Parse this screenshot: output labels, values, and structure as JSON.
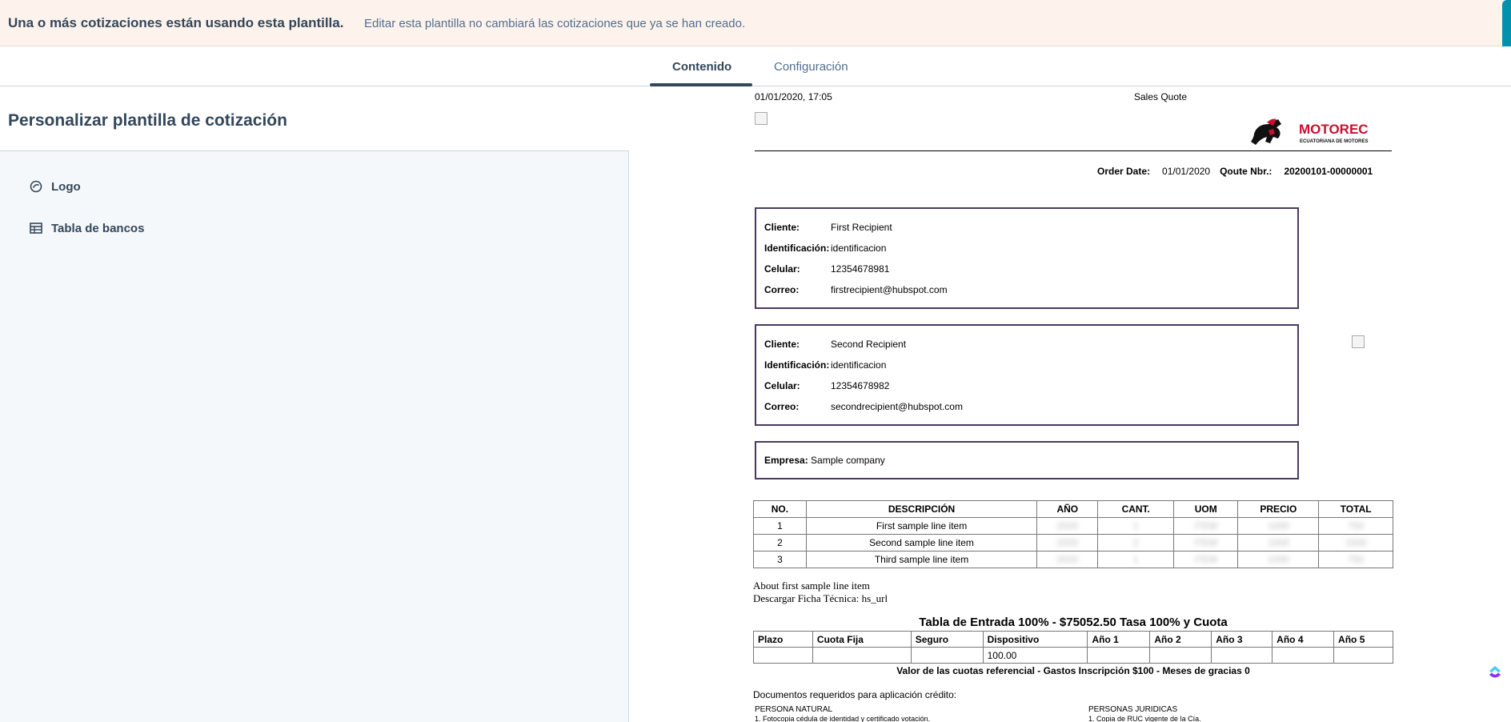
{
  "banner": {
    "title": "Una o más cotizaciones están usando esta plantilla.",
    "message": "Editar esta plantilla no cambiará las cotizaciones que ya se han creado."
  },
  "tabs": [
    {
      "label": "Contenido",
      "active": true
    },
    {
      "label": "Configuración",
      "active": false
    }
  ],
  "sidebar": {
    "title": "Personalizar plantilla de cotización",
    "items": [
      {
        "label": "Logo",
        "icon": "logo-icon"
      },
      {
        "label": "Tabla de bancos",
        "icon": "table-icon"
      }
    ]
  },
  "preview": {
    "date": "01/01/2020, 17:05",
    "doc_title": "Sales Quote",
    "logo": {
      "brand": "MOTOREC",
      "tagline": "ECUATORIANA DE MOTORES",
      "color": "#c8102e"
    },
    "order_date_label": "Order Date:",
    "order_date": "01/01/2020",
    "quote_nbr_label": "Qoute Nbr.:",
    "quote_nbr": "20200101-00000001",
    "recipients": [
      {
        "cliente_label": "Cliente:",
        "cliente": "First Recipient",
        "id_label": "Identificación:",
        "id": "identificacion",
        "cel_label": "Celular:",
        "cel": "12354678981",
        "correo_label": "Correo:",
        "correo": "firstrecipient@hubspot.com"
      },
      {
        "cliente_label": "Cliente:",
        "cliente": "Second Recipient",
        "id_label": "Identificación:",
        "id": "identificacion",
        "cel_label": "Celular:",
        "cel": "12354678982",
        "correo_label": "Correo:",
        "correo": "secondrecipient@hubspot.com"
      }
    ],
    "empresa_label": "Empresa:",
    "empresa": "Sample company",
    "items_table": {
      "headers": [
        "NO.",
        "DESCRIPCIÓN",
        "AÑO",
        "CANT.",
        "UOM",
        "PRECIO",
        "TOTAL"
      ],
      "rows": [
        [
          "1",
          "First sample line item",
          "2020",
          "1",
          "ITEM",
          "1000",
          "750"
        ],
        [
          "2",
          "Second sample line item",
          "2020",
          "2",
          "ITEM",
          "1000",
          "1500"
        ],
        [
          "3",
          "Third sample line item",
          "2020",
          "1",
          "ITEM",
          "1000",
          "750"
        ]
      ]
    },
    "about_line": "About first sample line item",
    "descargar_line": "Descargar Ficha Técnica: hs_url",
    "tabla_title": "Tabla de Entrada 100% - $75052.50 Tasa 100% y Cuota",
    "cuotas_table": {
      "headers": [
        "Plazo",
        "Cuota Fija",
        "Seguro",
        "Dispositivo",
        "Año 1",
        "Año 2",
        "Año 3",
        "Año 4",
        "Año 5"
      ],
      "row": [
        "",
        "",
        "",
        "100.00",
        "",
        "",
        "",
        "",
        ""
      ]
    },
    "valor_note": "Valor de las cuotas referencial - Gastos Inscripción $100 - Meses de gracias 0",
    "docs_req": "Documentos requeridos para aplicación crédito:",
    "persona_natural": "PERSONA NATURAL",
    "persona_natural_1": "1. Fotocopia cédula de identidad y certificado votación.",
    "personas_juridicas": "PERSONAS JURIDICAS",
    "personas_juridicas_1": "1. Copia de RUC vigente de la Cía."
  }
}
